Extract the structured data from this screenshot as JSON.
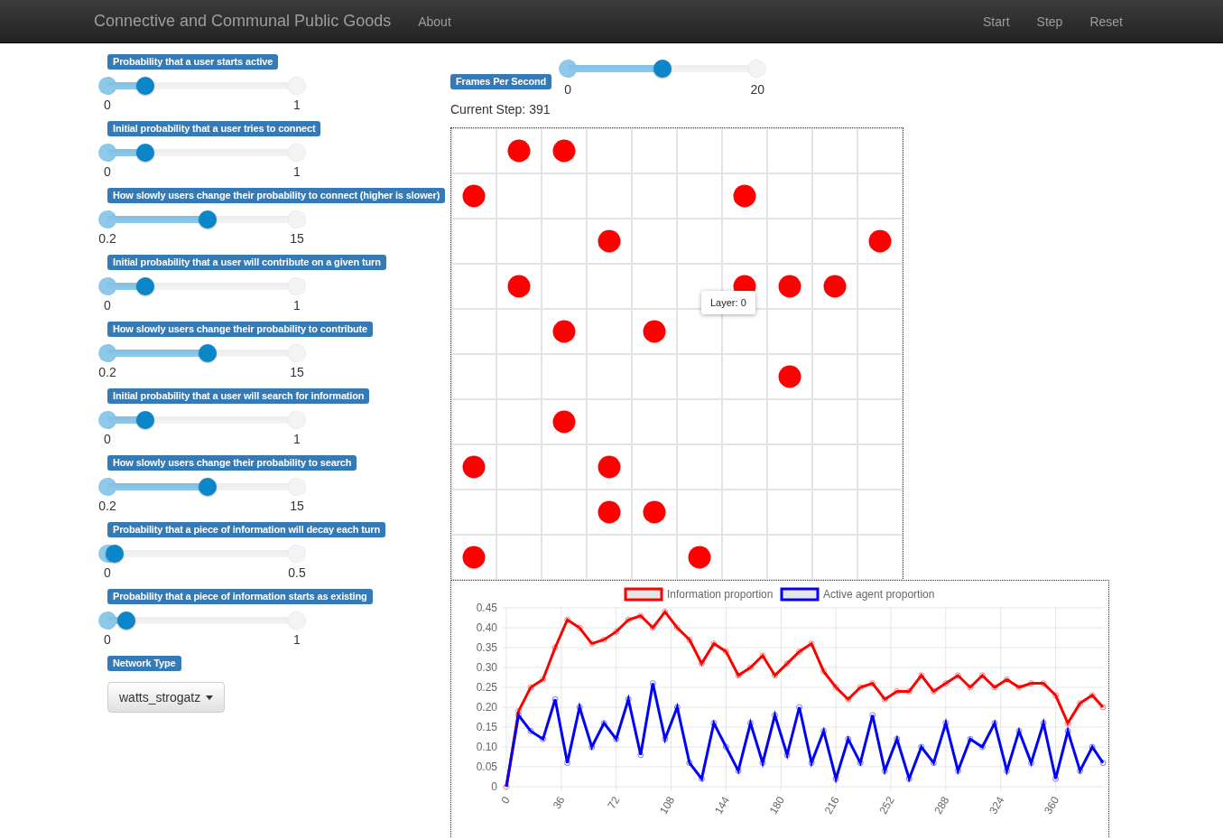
{
  "navbar": {
    "brand": "Connective and Communal Public Goods",
    "links": [
      "About"
    ],
    "actions": [
      "Start",
      "Step",
      "Reset"
    ]
  },
  "parameters": [
    {
      "label": "Probability that a user starts active",
      "min": "0",
      "max": "1",
      "level": 0.2
    },
    {
      "label": "Initial probability that a user tries to connect",
      "min": "0",
      "max": "1",
      "level": 0.2
    },
    {
      "label": "How slowly users change their probability to connect (higher is slower)",
      "min": "0.2",
      "max": "15",
      "level": 0.53
    },
    {
      "label": "Initial probability that a user will contribute on a given turn",
      "min": "0",
      "max": "1",
      "level": 0.2
    },
    {
      "label": "How slowly users change their probability to contribute",
      "min": "0.2",
      "max": "15",
      "level": 0.53
    },
    {
      "label": "Initial probability that a user will search for information",
      "min": "0",
      "max": "1",
      "level": 0.2
    },
    {
      "label": "How slowly users change their probability to search",
      "min": "0.2",
      "max": "15",
      "level": 0.53
    },
    {
      "label": "Probability that a piece of information will decay each turn",
      "min": "0",
      "max": "0.5",
      "level": 0.04
    },
    {
      "label": "Probability that a piece of information starts as existing",
      "min": "0",
      "max": "1",
      "level": 0.1
    }
  ],
  "network_type": {
    "label": "Network Type",
    "value": "watts_strogatz"
  },
  "fps": {
    "label": "Frames Per Second",
    "min": "0",
    "max": "20",
    "level": 0.5
  },
  "current_step": "Current Step: 391",
  "grid": {
    "rows": [
      [
        false,
        true,
        true,
        false,
        false,
        false,
        false,
        false,
        false,
        false
      ],
      [
        true,
        false,
        false,
        false,
        false,
        false,
        true,
        false,
        false,
        false
      ],
      [
        false,
        false,
        false,
        true,
        false,
        false,
        false,
        false,
        false,
        true
      ],
      [
        false,
        true,
        false,
        false,
        false,
        false,
        true,
        true,
        true,
        false
      ],
      [
        false,
        false,
        true,
        false,
        true,
        false,
        false,
        false,
        false,
        false
      ],
      [
        false,
        false,
        false,
        false,
        false,
        false,
        false,
        true,
        false,
        false
      ],
      [
        false,
        false,
        true,
        false,
        false,
        false,
        false,
        false,
        false,
        false
      ],
      [
        true,
        false,
        false,
        true,
        false,
        false,
        false,
        false,
        false,
        false
      ],
      [
        false,
        false,
        false,
        true,
        true,
        false,
        false,
        false,
        false,
        false
      ],
      [
        true,
        false,
        false,
        false,
        false,
        true,
        false,
        false,
        false,
        false
      ]
    ],
    "tooltip": "Layer: 0"
  },
  "chart": {
    "chart_data": {
      "type": "line",
      "grid": true,
      "legend": "top",
      "xlim": [
        0,
        391
      ],
      "x": [
        0,
        8,
        16,
        24,
        32,
        40,
        48,
        56,
        64,
        72,
        80,
        88,
        96,
        104,
        112,
        120,
        128,
        136,
        144,
        152,
        160,
        168,
        176,
        184,
        192,
        200,
        208,
        216,
        224,
        232,
        240,
        248,
        256,
        264,
        272,
        280,
        288,
        296,
        304,
        312,
        320,
        328,
        336,
        344,
        352,
        360,
        368,
        376,
        384,
        391
      ],
      "series": [
        {
          "name": "Information proportion",
          "color": "#ff0000",
          "marker": "circle",
          "values": [
            0,
            0.19,
            0.25,
            0.27,
            0.35,
            0.42,
            0.4,
            0.36,
            0.37,
            0.39,
            0.42,
            0.43,
            0.4,
            0.44,
            0.4,
            0.37,
            0.31,
            0.36,
            0.34,
            0.28,
            0.3,
            0.33,
            0.28,
            0.31,
            0.34,
            0.36,
            0.29,
            0.25,
            0.22,
            0.25,
            0.26,
            0.22,
            0.24,
            0.24,
            0.28,
            0.24,
            0.26,
            0.28,
            0.25,
            0.28,
            0.25,
            0.27,
            0.25,
            0.26,
            0.26,
            0.23,
            0.16,
            0.21,
            0.23,
            0.2
          ]
        },
        {
          "name": "Active agent proportion",
          "color": "#0000ff",
          "marker": "circle",
          "values": [
            0,
            0.18,
            0.14,
            0.12,
            0.22,
            0.06,
            0.2,
            0.1,
            0.16,
            0.12,
            0.22,
            0.08,
            0.26,
            0.12,
            0.2,
            0.06,
            0.02,
            0.16,
            0.1,
            0.04,
            0.16,
            0.06,
            0.18,
            0.08,
            0.2,
            0.06,
            0.14,
            0.02,
            0.12,
            0.06,
            0.18,
            0.04,
            0.12,
            0.02,
            0.1,
            0.06,
            0.16,
            0.04,
            0.12,
            0.1,
            0.16,
            0.04,
            0.14,
            0.06,
            0.16,
            0.02,
            0.14,
            0.04,
            0.1,
            0.06
          ]
        }
      ],
      "xticks": [
        0,
        36,
        72,
        108,
        144,
        180,
        216,
        252,
        288,
        324,
        360
      ],
      "yticks": [
        0,
        0.05,
        {
          "value": 0.1,
          "label": "0.10"
        },
        0.15,
        {
          "value": 0.2,
          "label": "0.20"
        },
        0.25,
        {
          "value": 0.3,
          "label": "0.30"
        },
        0.35,
        {
          "value": 0.4,
          "label": "0.40"
        },
        0.45
      ],
      "ylim": [
        0,
        0.45
      ]
    }
  }
}
